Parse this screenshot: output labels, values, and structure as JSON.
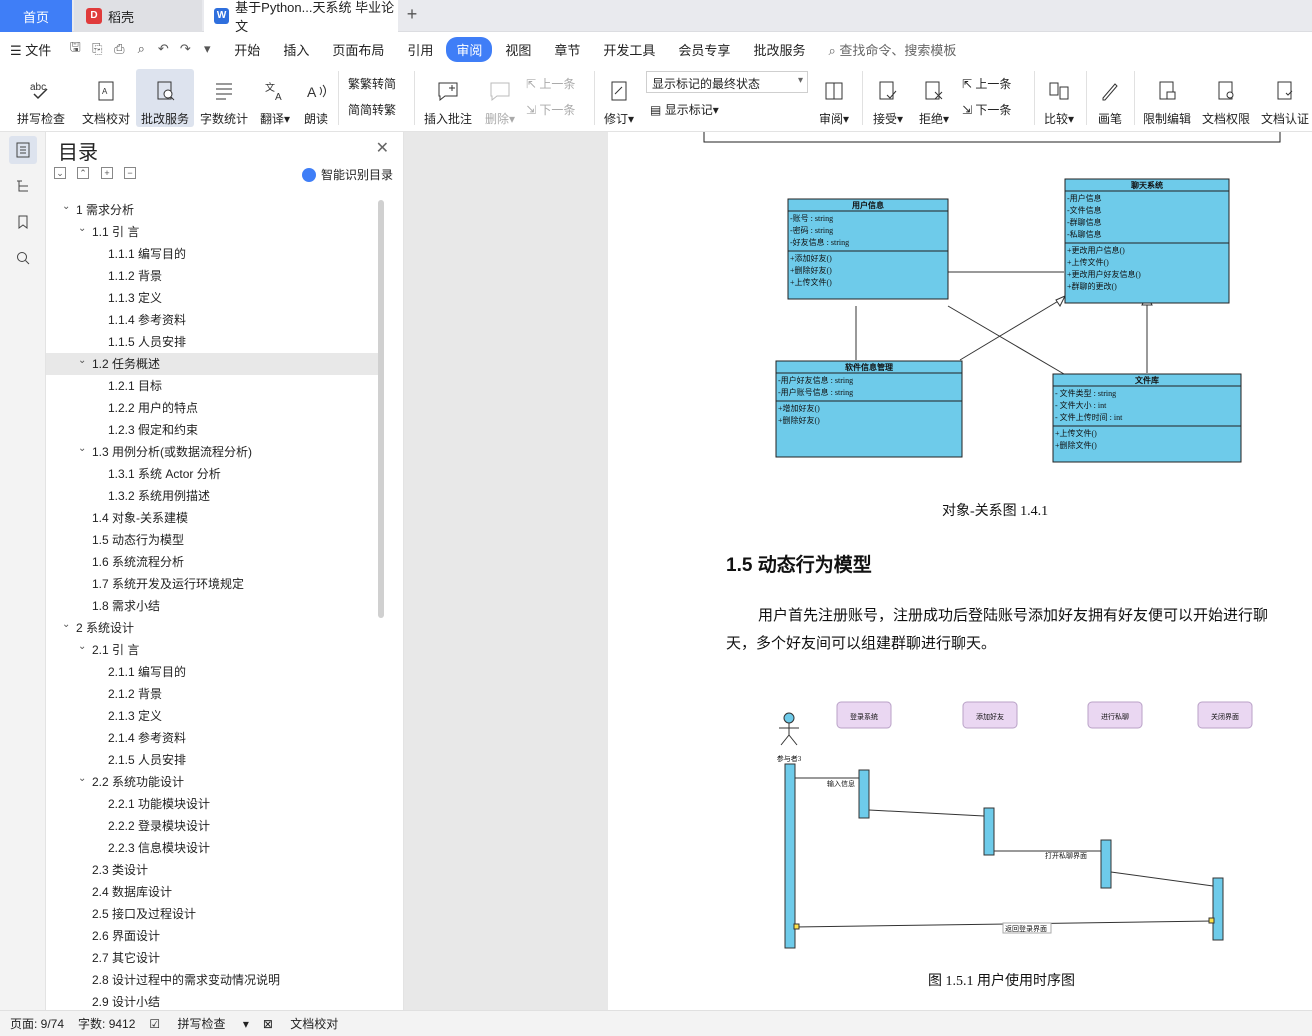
{
  "tabs": {
    "home": "首页",
    "daoke": "稻壳",
    "doc": "基于Python...天系统 毕业论文",
    "add": "+"
  },
  "menu": {
    "file": "文件",
    "items": [
      "开始",
      "插入",
      "页面布局",
      "引用",
      "审阅",
      "视图",
      "章节",
      "开发工具",
      "会员专享",
      "批改服务"
    ],
    "active": "审阅",
    "search": "查找命令、搜索模板"
  },
  "ribbon": {
    "spell": "拼写检查",
    "check": "文档校对",
    "correct": "批改服务",
    "count": "字数统计",
    "translate": "翻译",
    "read": "朗读",
    "trad": "繁转简",
    "simp": "简转繁",
    "insert_comment": "插入批注",
    "delete": "删除",
    "prev": "上一条",
    "next": "下一条",
    "revise": "修订",
    "markup_state": "显示标记的最终状态",
    "show_markup": "显示标记",
    "review": "审阅",
    "accept": "接受",
    "reject": "拒绝",
    "prev2": "上一条",
    "next2": "下一条",
    "compare": "比较",
    "pen": "画笔",
    "restrict": "限制编辑",
    "perm": "文档权限",
    "auth": "文档认证"
  },
  "toc": {
    "title": "目录",
    "smart": "智能识别目录",
    "items": [
      {
        "t": "1  需求分析",
        "l": 1,
        "a": "v"
      },
      {
        "t": "1.1  引    言",
        "l": 2,
        "a": "v"
      },
      {
        "t": "1.1.1  编写目的",
        "l": 3
      },
      {
        "t": "1.1.2 背景",
        "l": 3
      },
      {
        "t": "1.1.3 定义",
        "l": 3
      },
      {
        "t": "1.1.4 参考资料",
        "l": 3
      },
      {
        "t": "1.1.5 人员安排",
        "l": 3
      },
      {
        "t": "1.2  任务概述",
        "l": 2,
        "a": "v",
        "sel": true
      },
      {
        "t": "1.2.1 目标",
        "l": 3
      },
      {
        "t": "1.2.2 用户的特点",
        "l": 3
      },
      {
        "t": "1.2.3 假定和约束",
        "l": 3
      },
      {
        "t": "1.3  用例分析(或数据流程分析)",
        "l": 2,
        "a": "v"
      },
      {
        "t": "1.3.1  系统 Actor 分析",
        "l": 3
      },
      {
        "t": "1.3.2  系统用例描述",
        "l": 3
      },
      {
        "t": "1.4  对象-关系建模",
        "l": 2
      },
      {
        "t": "1.5  动态行为模型",
        "l": 2
      },
      {
        "t": "1.6  系统流程分析",
        "l": 2
      },
      {
        "t": "1.7  系统开发及运行环境规定",
        "l": 2
      },
      {
        "t": "1.8  需求小结",
        "l": 2
      },
      {
        "t": "2  系统设计",
        "l": 1,
        "a": "v"
      },
      {
        "t": "2.1  引    言",
        "l": 2,
        "a": "v"
      },
      {
        "t": "2.1.1 编写目的",
        "l": 3
      },
      {
        "t": "2.1.2 背景",
        "l": 3
      },
      {
        "t": "2.1.3 定义",
        "l": 3
      },
      {
        "t": "2.1.4 参考资料",
        "l": 3
      },
      {
        "t": "2.1.5 人员安排",
        "l": 3
      },
      {
        "t": "2.2  系统功能设计",
        "l": 2,
        "a": "v"
      },
      {
        "t": "2.2.1  功能模块设计",
        "l": 3
      },
      {
        "t": "2.2.2  登录模块设计",
        "l": 3
      },
      {
        "t": "2.2.3  信息模块设计",
        "l": 3
      },
      {
        "t": "2.3  类设计",
        "l": 2
      },
      {
        "t": "2.4  数据库设计",
        "l": 2
      },
      {
        "t": "2.5  接口及过程设计",
        "l": 2
      },
      {
        "t": "2.6  界面设计",
        "l": 2
      },
      {
        "t": "2.7  其它设计",
        "l": 2
      },
      {
        "t": "2.8  设计过程中的需求变动情况说明",
        "l": 2
      },
      {
        "t": "2.9  设计小结",
        "l": 2
      }
    ]
  },
  "doc": {
    "uml": {
      "user": {
        "title": "用户信息",
        "attrs": [
          "-账号 : string",
          "-密码 : string",
          "-好友信息 : string"
        ],
        "ops": [
          "+添加好友()",
          "+删除好友()",
          "+上传文件()"
        ]
      },
      "chat": {
        "title": "聊天系统",
        "attrs": [
          "-用户信息",
          "-文件信息",
          "-群聊信息",
          "-私聊信息"
        ],
        "ops": [
          "+更改用户信息()",
          "+上传文件()",
          "+更改用户好友信息()",
          "+群聊的更改()"
        ]
      },
      "soft": {
        "title": "软件信息管理",
        "attrs": [
          "-用户好友信息 : string",
          "-用户账号信息 : string"
        ],
        "ops": [
          "+增加好友()",
          "+删除好友()"
        ]
      },
      "file": {
        "title": "文件库",
        "attrs": [
          "- 文件类型 : string",
          "- 文件大小 : int",
          "- 文件上传时间 : int"
        ],
        "ops": [
          "+上传文件()",
          "+删除文件()"
        ]
      }
    },
    "cap1": "对象-关系图 1.4.1",
    "heading": "1.5  动态行为模型",
    "para": "用户首先注册账号，注册成功后登陆账号添加好友拥有好友便可以开始进行聊天，多个好友间可以组建群聊进行聊天。",
    "seq": {
      "actor": "参与者3",
      "objs": [
        "登录系统",
        "添加好友",
        "进行私聊",
        "关闭界面"
      ],
      "msg1": "输入信息",
      "msg2": "打开私聊界面",
      "msg3": "返回登录界面"
    },
    "cap2": "图 1.5.1  用户使用时序图"
  },
  "status": {
    "page": "页面: 9/74",
    "words": "字数: 9412",
    "spell": "拼写检查",
    "check": "文档校对"
  },
  "colors": {
    "accent": "#3f7ef7",
    "uml_fill": "#6ecbea",
    "seq_box": "#ead7f2"
  }
}
